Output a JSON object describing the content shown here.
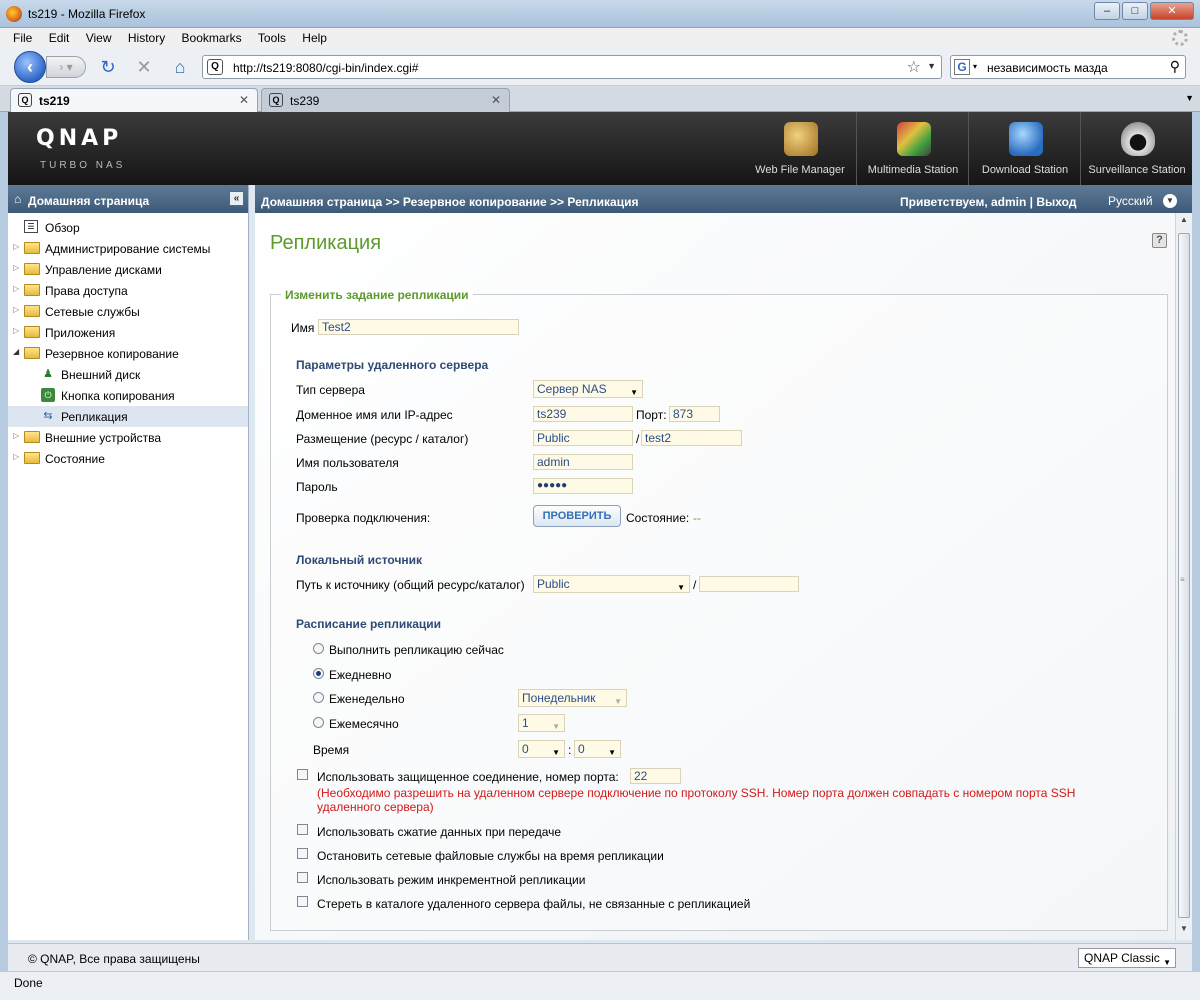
{
  "window": {
    "title": "ts219 - Mozilla Firefox",
    "min": "–",
    "max": "□",
    "close": "✕"
  },
  "menu": [
    "File",
    "Edit",
    "View",
    "History",
    "Bookmarks",
    "Tools",
    "Help"
  ],
  "nav": {
    "url": "http://ts219:8080/cgi-bin/index.cgi#",
    "search_query": "независимость мазда"
  },
  "tabs": [
    {
      "label": "ts219",
      "active": true
    },
    {
      "label": "ts239",
      "active": false
    }
  ],
  "qnap": {
    "logo": "QNAP",
    "subtitle": "TURBO NAS",
    "apps": [
      {
        "label": "Web File Manager",
        "icon": "web-file-manager-icon",
        "color": "#c89a3a"
      },
      {
        "label": "Multimedia Station",
        "icon": "multimedia-station-icon",
        "color": "#7a9a3a"
      },
      {
        "label": "Download Station",
        "icon": "download-station-icon",
        "color": "#3a7ac8"
      },
      {
        "label": "Surveillance Station",
        "icon": "surveillance-station-icon",
        "color": "#d0d0d0"
      }
    ]
  },
  "sidebar": {
    "title": "Домашняя страница",
    "collapse": "«",
    "items": [
      {
        "label": "Обзор",
        "type": "overview"
      },
      {
        "label": "Администрирование системы",
        "type": "folder"
      },
      {
        "label": "Управление дисками",
        "type": "folder"
      },
      {
        "label": "Права доступа",
        "type": "folder"
      },
      {
        "label": "Сетевые службы",
        "type": "folder"
      },
      {
        "label": "Приложения",
        "type": "folder"
      },
      {
        "label": "Резервное копирование",
        "type": "folder-open"
      },
      {
        "label": "Внешний диск",
        "type": "sub"
      },
      {
        "label": "Кнопка копирования",
        "type": "sub"
      },
      {
        "label": "Репликация",
        "type": "sub",
        "selected": true
      },
      {
        "label": "Внешние устройства",
        "type": "folder"
      },
      {
        "label": "Состояние",
        "type": "folder"
      }
    ]
  },
  "header": {
    "breadcrumb": "Домашняя страница >> Резервное копирование >> Репликация",
    "welcome": "Приветствуем,  admin | Выход",
    "language": "Русский"
  },
  "page": {
    "title": "Репликация",
    "help": "?",
    "legend": "Изменить задание репликации",
    "name_label": "Имя",
    "name_value": "Test2",
    "remote": {
      "section": "Параметры удаленного сервера",
      "server_type_label": "Тип сервера",
      "server_type_value": "Сервер NAS",
      "host_label": "Доменное имя или IP-адрес",
      "host_value": "ts239",
      "port_label": "Порт:",
      "port_value": "873",
      "location_label": "Размещение (ресурс / каталог)",
      "location_share": "Public",
      "location_sep": "/",
      "location_dir": "test2",
      "user_label": "Имя пользователя",
      "user_value": "admin",
      "password_label": "Пароль",
      "password_value": "●●●●●",
      "check_label": "Проверка подключения:",
      "check_button": "ПРОВЕРИТЬ",
      "status_label": "Состояние:",
      "status_value": "--"
    },
    "local": {
      "section": "Локальный источник",
      "path_label": "Путь к источнику (общий ресурс/каталог)",
      "path_share": "Public",
      "path_sep": "/",
      "path_dir": ""
    },
    "schedule": {
      "section": "Расписание репликации",
      "now": "Выполнить репликацию сейчас",
      "daily": "Ежедневно",
      "weekly": "Еженедельно",
      "weekly_value": "Понедельник",
      "monthly": "Ежемесячно",
      "monthly_value": "1",
      "time_label": "Время",
      "hour": "0",
      "time_sep": ":",
      "minute": "0",
      "selected": "daily"
    },
    "options": {
      "ssh_label": "Использовать защищенное соединение, номер порта:",
      "ssh_port": "22",
      "ssh_warning_1": "(Необходимо разрешить на удаленном сервере подключение по протоколу SSH. Номер порта должен совпадать с номером порта SSH",
      "ssh_warning_2": "удаленного сервера)",
      "compress": "Использовать сжатие данных при передаче",
      "stop_services": "Остановить сетевые файловые службы на время репликации",
      "incremental": "Использовать режим инкрементной репликации",
      "delete_extra": "Стереть в каталоге удаленного сервера файлы, не связанные с репликацией"
    }
  },
  "footer": {
    "copyright": "© QNAP, Все права защищены",
    "theme": "QNAP Classic"
  },
  "status": "Done"
}
